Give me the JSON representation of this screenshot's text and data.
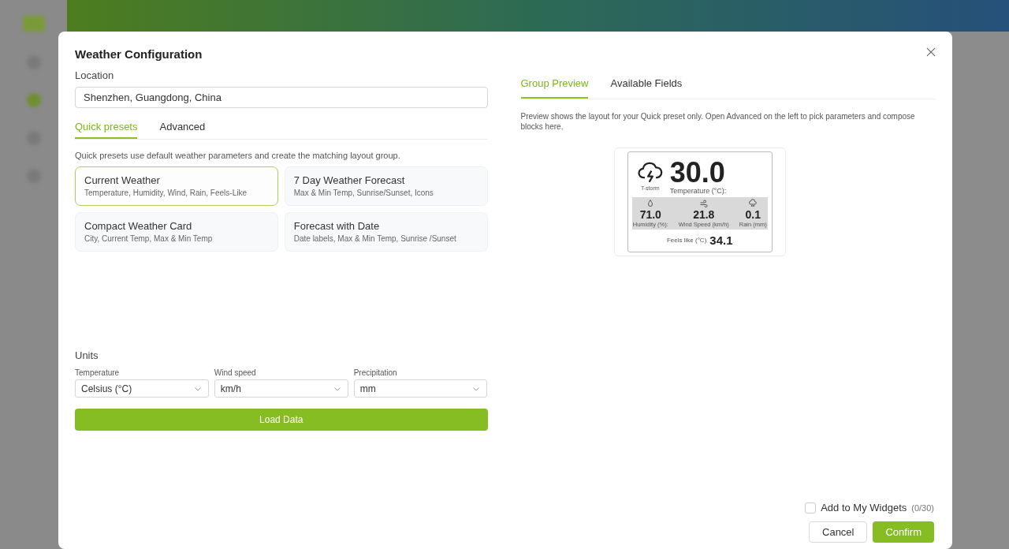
{
  "dialog": {
    "title": "Weather Configuration",
    "location": {
      "label": "Location",
      "value": "Shenzhen, Guangdong, China"
    },
    "mode_tabs": [
      {
        "label": "Quick presets",
        "selected": true
      },
      {
        "label": "Advanced",
        "selected": false
      }
    ],
    "presets_hint": "Quick presets use default weather parameters and create the matching layout group.",
    "presets": [
      {
        "title": "Current Weather",
        "subtitle": "Temperature, Humidity, Wind, Rain, Feels-Like",
        "selected": true
      },
      {
        "title": "7 Day Weather Forecast",
        "subtitle": "Max & Min Temp, Sunrise/Sunset, Icons",
        "selected": false
      },
      {
        "title": "Compact Weather Card",
        "subtitle": "City, Current Temp, Max & Min Temp",
        "selected": false
      },
      {
        "title": "Forecast with Date",
        "subtitle": "Date labels, Max & Min Temp, Sunrise /Sunset",
        "selected": false
      }
    ],
    "units": {
      "title": "Units",
      "fields": [
        {
          "label": "Temperature",
          "value": "Celsius (°C)"
        },
        {
          "label": "Wind speed",
          "value": "km/h"
        },
        {
          "label": "Precipitation",
          "value": "mm"
        }
      ]
    },
    "load_button": "Load Data",
    "preview_tabs": [
      {
        "label": "Group Preview",
        "selected": true
      },
      {
        "label": "Available Fields",
        "selected": false
      }
    ],
    "preview_note": "Preview shows the layout for your Quick preset only. Open Advanced on the left to pick parameters and compose blocks here.",
    "preview_card": {
      "condition": "T-storm",
      "temperature": "30.0",
      "temperature_label": "Temperature (°C):",
      "metrics": [
        {
          "kind": "humidity",
          "value": "71.0",
          "label": "Humidity (%):"
        },
        {
          "kind": "wind",
          "value": "21.8",
          "label": "Wind Speed (km/h)"
        },
        {
          "kind": "rain",
          "value": "0.1",
          "label": "Rain (mm)"
        }
      ],
      "feels_like_label": "Feels like (°C)",
      "feels_like": "34.1"
    },
    "add_to_widgets": {
      "label": "Add to My Widgets",
      "checked": false,
      "count": "(0/30)"
    },
    "buttons": [
      {
        "label": "Cancel",
        "kind": "secondary"
      },
      {
        "label": "Confirm",
        "kind": "primary"
      }
    ]
  }
}
